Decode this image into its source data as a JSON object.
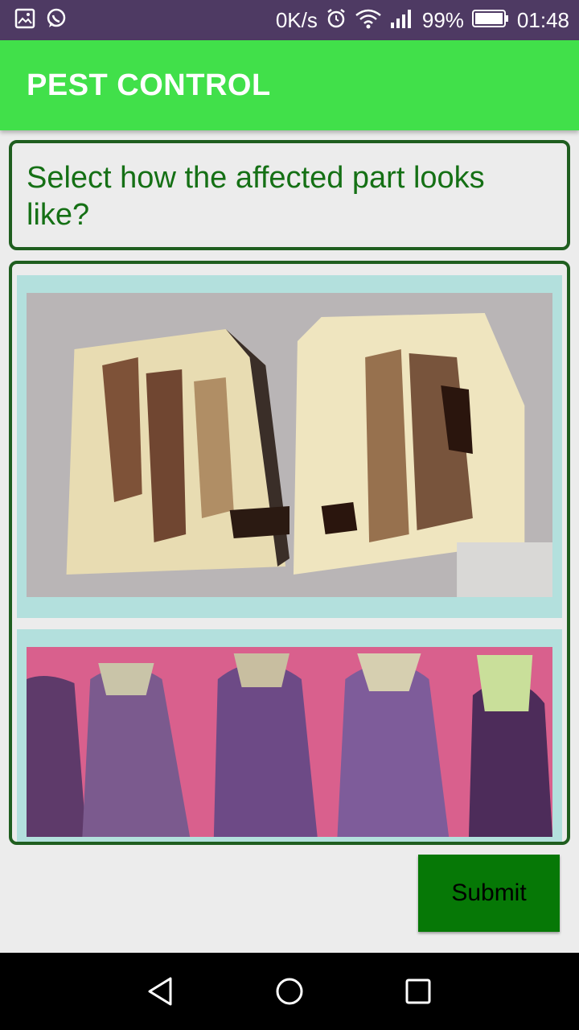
{
  "status_bar": {
    "network_speed": "0K/s",
    "battery": "99%",
    "time": "01:48",
    "icons": [
      "gallery-icon",
      "whatsapp-icon",
      "alarm-icon",
      "wifi-icon",
      "signal-icon",
      "battery-icon"
    ]
  },
  "app_bar": {
    "title": "PEST CONTROL",
    "color": "#41e04a"
  },
  "question": {
    "text": "Select how the affected part looks like?",
    "text_color": "#157015"
  },
  "options": [
    {
      "id": "option-1",
      "depicts": "cut-eggplant-damage-photo"
    },
    {
      "id": "option-2",
      "depicts": "purple-eggplants-photo"
    }
  ],
  "actions": {
    "submit_label": "Submit",
    "submit_color": "#067806"
  },
  "nav_bar": {
    "icons": [
      "back-icon",
      "home-icon",
      "recents-icon"
    ]
  }
}
